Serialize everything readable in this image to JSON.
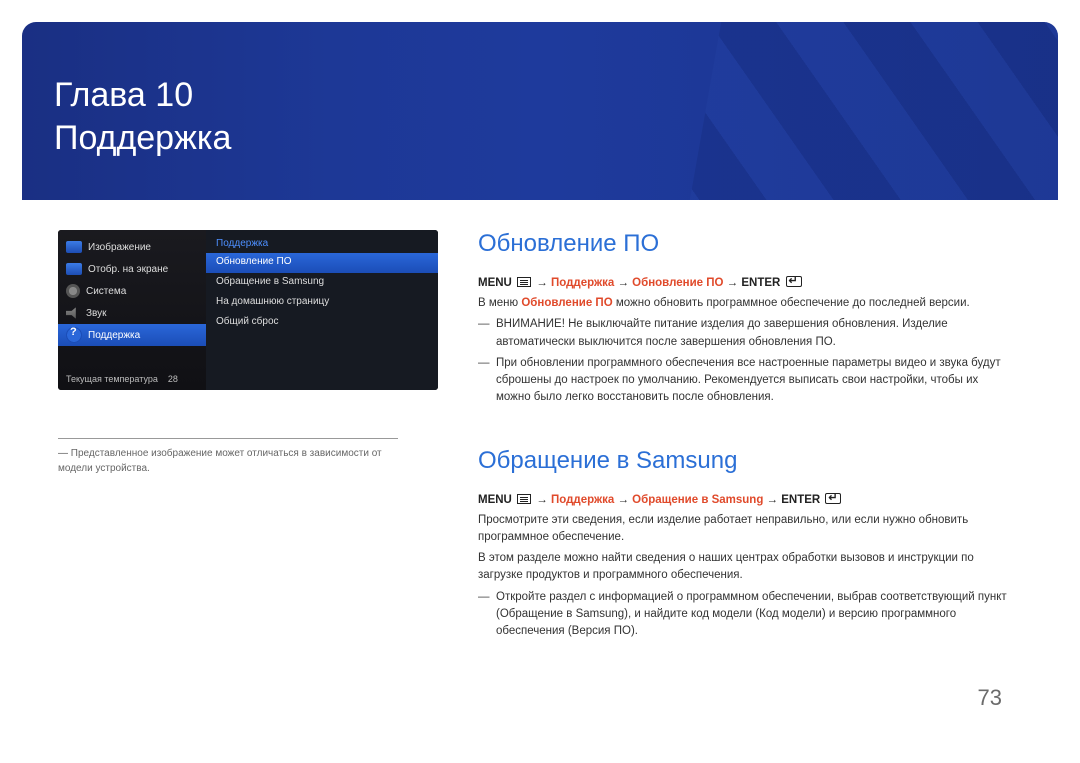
{
  "chapter": {
    "line1": "Глава 10",
    "line2": "Поддержка"
  },
  "osd": {
    "left": [
      {
        "label": "Изображение",
        "icon": "pict"
      },
      {
        "label": "Отобр. на экране",
        "icon": "pict"
      },
      {
        "label": "Система",
        "icon": "gear"
      },
      {
        "label": "Звук",
        "icon": "sound"
      },
      {
        "label": "Поддержка",
        "icon": "help",
        "selected": true
      }
    ],
    "temp_label": "Текущая температура",
    "temp_value": "28",
    "right_head": "Поддержка",
    "right": [
      {
        "label": "Обновление ПО",
        "selected": true
      },
      {
        "label": "Обращение в Samsung"
      },
      {
        "label": "На домашнюю страницу"
      },
      {
        "label": "Общий сброс"
      }
    ]
  },
  "footnote": "Представленное изображение может отличаться в зависимости от модели устройства.",
  "section1": {
    "title": "Обновление ПО",
    "path_pre": "MENU ",
    "path_mid1": " → ",
    "path_a1": "Поддержка",
    "path_mid2": " → ",
    "path_a2": "Обновление ПО",
    "path_mid3": " → ENTER ",
    "body1_a": "В меню ",
    "body1_accent": "Обновление ПО",
    "body1_b": " можно обновить программное обеспечение до последней версии.",
    "note1": "ВНИМАНИЕ! Не выключайте питание изделия до завершения обновления. Изделие автоматически выключится после завершения обновления ПО.",
    "note2": "При обновлении программного обеспечения все настроенные параметры видео и звука будут сброшены до настроек по умолчанию. Рекомендуется выписать свои настройки, чтобы их можно было легко восстановить после обновления."
  },
  "section2": {
    "title": "Обращение в Samsung",
    "path_pre": "MENU ",
    "path_mid1": " → ",
    "path_a1": "Поддержка",
    "path_mid2": " → ",
    "path_a2": "Обращение в Samsung",
    "path_mid3": " → ENTER ",
    "body1": "Просмотрите эти сведения, если изделие работает неправильно, или если нужно обновить программное обеспечение.",
    "body2": "В этом разделе можно найти сведения о наших центрах обработки вызовов и инструкции по загрузке продуктов и программного обеспечения.",
    "note_a": "Откройте раздел с информацией о программном обеспечении, выбрав соответствующий пункт (",
    "note_accent1": "Обращение в Samsung",
    "note_b": "), и найдите код модели (",
    "note_accent2": "Код модели",
    "note_c": ") и версию программного обеспечения (",
    "note_accent3": "Версия ПО",
    "note_d": ")."
  },
  "page_number": "73"
}
